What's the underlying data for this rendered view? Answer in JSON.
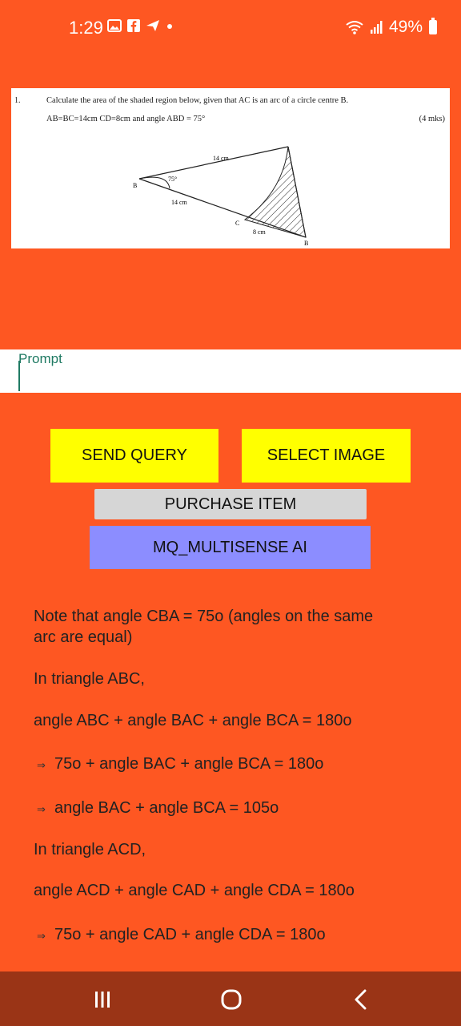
{
  "status_bar": {
    "time": "1:29",
    "battery": "49%"
  },
  "question": {
    "number": "1.",
    "line1": "Calculate the area of the shaded region below, given that AC is an arc of a circle centre B.",
    "line2": "AB=BC=14cm CD=8cm and angle ABD = 75°",
    "marks": "(4 mks)",
    "diagram": {
      "label_top": "14 cm",
      "label_angle": "75°",
      "label_B_left": "B",
      "label_mid": "14 cm",
      "label_C": "C",
      "label_8cm": "8 cm",
      "label_B_right": "B"
    }
  },
  "prompt": {
    "placeholder": "Prompt"
  },
  "buttons": {
    "send": "SEND QUERY",
    "select": "SELECT IMAGE",
    "purchase": "PURCHASE ITEM",
    "multisense": "MQ_MULTISENSE AI"
  },
  "answer": {
    "line1": " Note that angle CBA = 75o (angles on the same",
    "line1b": "arc are equal)",
    "line2": "In triangle ABC,",
    "line3": "angle ABC + angle BAC + angle BCA = 180o",
    "line4": "75o + angle BAC + angle BCA = 180o",
    "line5": "angle BAC + angle BCA = 105o",
    "line6": "In triangle ACD,",
    "line7": "angle ACD + angle CAD + angle CDA = 180o",
    "line8": "75o + angle CAD + angle CDA = 180o",
    "arrow_symbol": "⇒"
  }
}
